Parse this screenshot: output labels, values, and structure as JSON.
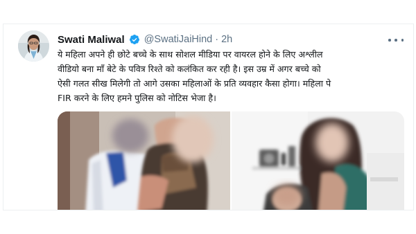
{
  "tweet": {
    "author": {
      "display_name": "Swati Maliwal",
      "handle_time": "@SwatiJaiHind · 2h"
    },
    "text_lines": [
      "ये महिला अपने ही छोटे बच्चे के साथ सोशल मीडिया पर वायरल होने के लिए अश्लील",
      "वीडियो बना माँ बेटे के पवित्र रिश्ते को कलंकित कर रही है। इस उम्र में अगर बच्चे को",
      "ऐसी गलत सीख मिलेगी तो आगे उसका महिलाओं के प्रति व्यवहार कैसा होगा। महिला पे",
      "FIR करने के लिए हमने पुलिस को नोटिस भेजा है।"
    ],
    "media": [
      {
        "content": "blurred-photo"
      },
      {
        "content": "blurred-photo"
      }
    ]
  },
  "icons": {
    "verified": "verified-badge-icon",
    "more": "more-options-icon"
  },
  "colors": {
    "text_primary": "#14171a",
    "text_secondary": "#5b7083",
    "verified_blue": "#1da1f2",
    "border": "#eceff1"
  }
}
